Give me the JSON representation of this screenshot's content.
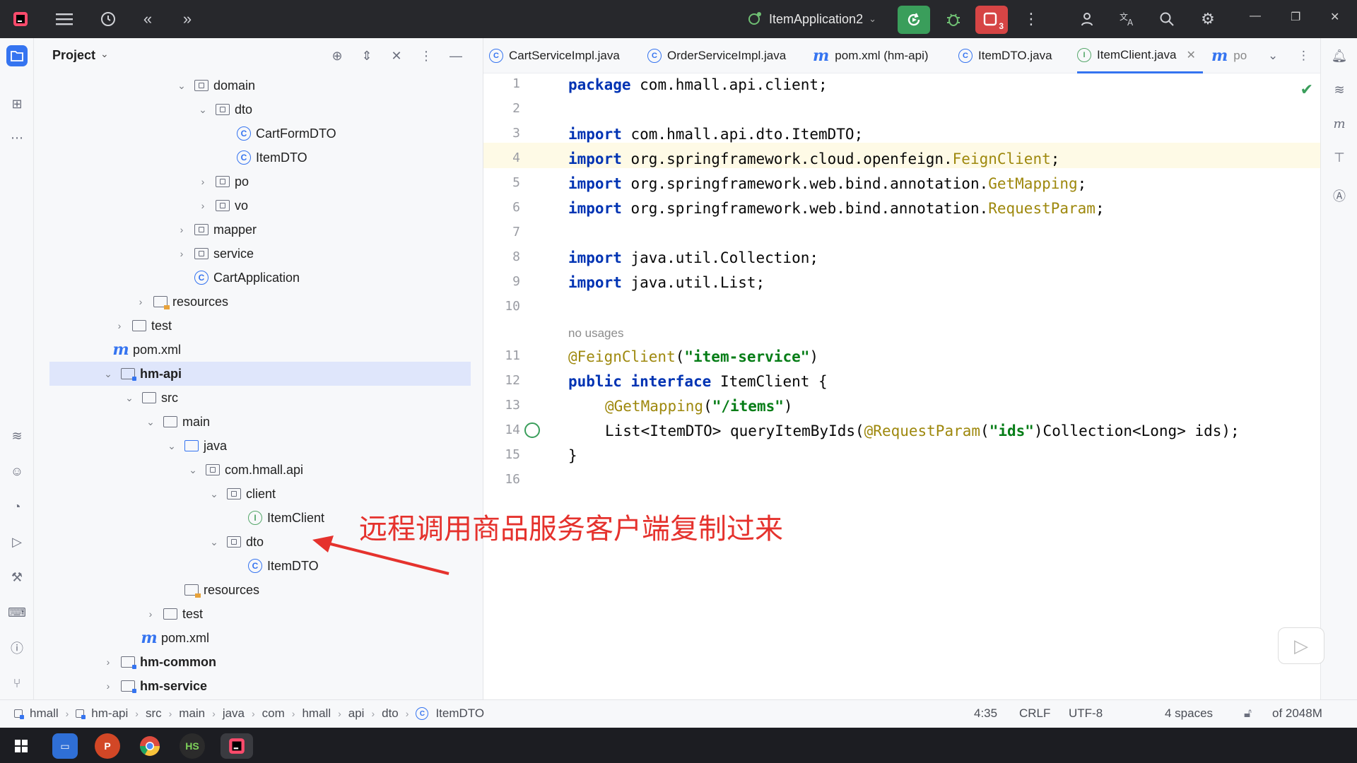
{
  "titlebar": {
    "run_config": "ItemApplication2",
    "colors": {
      "bg": "#27282c",
      "run_green": "#3a9e5b",
      "stop_red": "#d64545"
    },
    "stop_badge": "3"
  },
  "project": {
    "title": "Project",
    "tree": [
      {
        "label": "domain",
        "icon": "package-folder-icon",
        "expanded": true
      },
      {
        "label": "dto",
        "icon": "package-folder-icon",
        "expanded": true
      },
      {
        "label": "CartFormDTO",
        "icon": "class-icon"
      },
      {
        "label": "ItemDTO",
        "icon": "class-icon"
      },
      {
        "label": "po",
        "icon": "package-folder-icon",
        "expanded": false
      },
      {
        "label": "vo",
        "icon": "package-folder-icon",
        "expanded": false
      },
      {
        "label": "mapper",
        "icon": "package-folder-icon",
        "expanded": false
      },
      {
        "label": "service",
        "icon": "package-folder-icon",
        "expanded": false
      },
      {
        "label": "CartApplication",
        "icon": "spring-class-icon"
      },
      {
        "label": "resources",
        "icon": "resources-folder-icon",
        "expanded": false
      },
      {
        "label": "test",
        "icon": "folder-icon",
        "expanded": false
      },
      {
        "label": "pom.xml",
        "icon": "maven-icon"
      },
      {
        "label": "hm-api",
        "icon": "module-folder-icon",
        "expanded": true
      },
      {
        "label": "src",
        "icon": "folder-icon",
        "expanded": true
      },
      {
        "label": "main",
        "icon": "folder-icon",
        "expanded": true
      },
      {
        "label": "java",
        "icon": "source-folder-icon",
        "expanded": true
      },
      {
        "label": "com.hmall.api",
        "icon": "package-folder-icon",
        "expanded": true
      },
      {
        "label": "client",
        "icon": "package-folder-icon",
        "expanded": true
      },
      {
        "label": "ItemClient",
        "icon": "interface-icon"
      },
      {
        "label": "dto",
        "icon": "package-folder-icon",
        "expanded": true
      },
      {
        "label": "ItemDTO",
        "icon": "class-icon"
      },
      {
        "label": "resources",
        "icon": "resources-folder-icon"
      },
      {
        "label": "test",
        "icon": "folder-icon",
        "expanded": false
      },
      {
        "label": "pom.xml",
        "icon": "maven-icon"
      },
      {
        "label": "hm-common",
        "icon": "module-folder-icon",
        "expanded": false
      },
      {
        "label": "hm-service",
        "icon": "module-folder-icon",
        "expanded": false
      }
    ]
  },
  "tabs": [
    {
      "label": "CartServiceImpl.java",
      "icon": "class-icon"
    },
    {
      "label": "OrderServiceImpl.java",
      "icon": "class-icon"
    },
    {
      "label": "pom.xml (hm-api)",
      "icon": "maven-icon"
    },
    {
      "label": "ItemDTO.java",
      "icon": "class-icon"
    },
    {
      "label": "ItemClient.java",
      "icon": "interface-icon",
      "active": true
    },
    {
      "label": "po",
      "icon": "maven-icon"
    }
  ],
  "editor": {
    "line_numbers": [
      "1",
      "2",
      "3",
      "4",
      "5",
      "6",
      "7",
      "8",
      "9",
      "10",
      "11",
      "12",
      "13",
      "14",
      "15",
      "16"
    ],
    "hint": "no usages",
    "code": {
      "l1_kw": "package",
      "l1_rest": " com.hmall.api.client;",
      "l3_kw": "import",
      "l3_rest": " com.hmall.api.dto.ItemDTO;",
      "l4_kw": "import",
      "l4_rest": " org.springframework.cloud.openfeign.",
      "l4_ref": "FeignClient",
      "l4_end": ";",
      "l5_kw": "import",
      "l5_rest": " org.springframework.web.bind.annotation.",
      "l5_ref": "GetMapping",
      "l5_end": ";",
      "l6_kw": "import",
      "l6_rest": " org.springframework.web.bind.annotation.",
      "l6_ref": "RequestParam",
      "l6_end": ";",
      "l8_kw": "import",
      "l8_rest": " java.util.Collection;",
      "l9_kw": "import",
      "l9_rest": " java.util.List;",
      "l11_ann": "@FeignClient",
      "l11_open": "(",
      "l11_str": "\"item-service\"",
      "l11_close": ")",
      "l12_kw1": "public",
      "l12_kw2": " interface",
      "l12_rest": " ItemClient {",
      "l13_ann": "@GetMapping",
      "l13_open": "(",
      "l13_str": "\"/items\"",
      "l13_close": ")",
      "l14_a": "List<ItemDTO> queryItemByIds(",
      "l14_ann": "@RequestParam",
      "l14_open": "(",
      "l14_str": "\"ids\"",
      "l14_b": ")Collection<Long> ids);",
      "l15": "}"
    }
  },
  "statusbar": {
    "breadcrumbs": [
      "hmall",
      "hm-api",
      "src",
      "main",
      "java",
      "com",
      "hmall",
      "api",
      "dto",
      "ItemDTO"
    ],
    "position": "4:35",
    "line_sep": "CRLF",
    "encoding": "UTF-8",
    "indent": "4 spaces",
    "memory": "of 2048M"
  },
  "annotation": {
    "text": "远程调用商品服务客户端复制过来",
    "color": "#e5322d"
  },
  "taskbar": {
    "apps": [
      "start-icon",
      "file-explorer-icon",
      "powerpoint-icon",
      "chrome-icon",
      "hbuilder-icon",
      "intellij-icon"
    ]
  }
}
